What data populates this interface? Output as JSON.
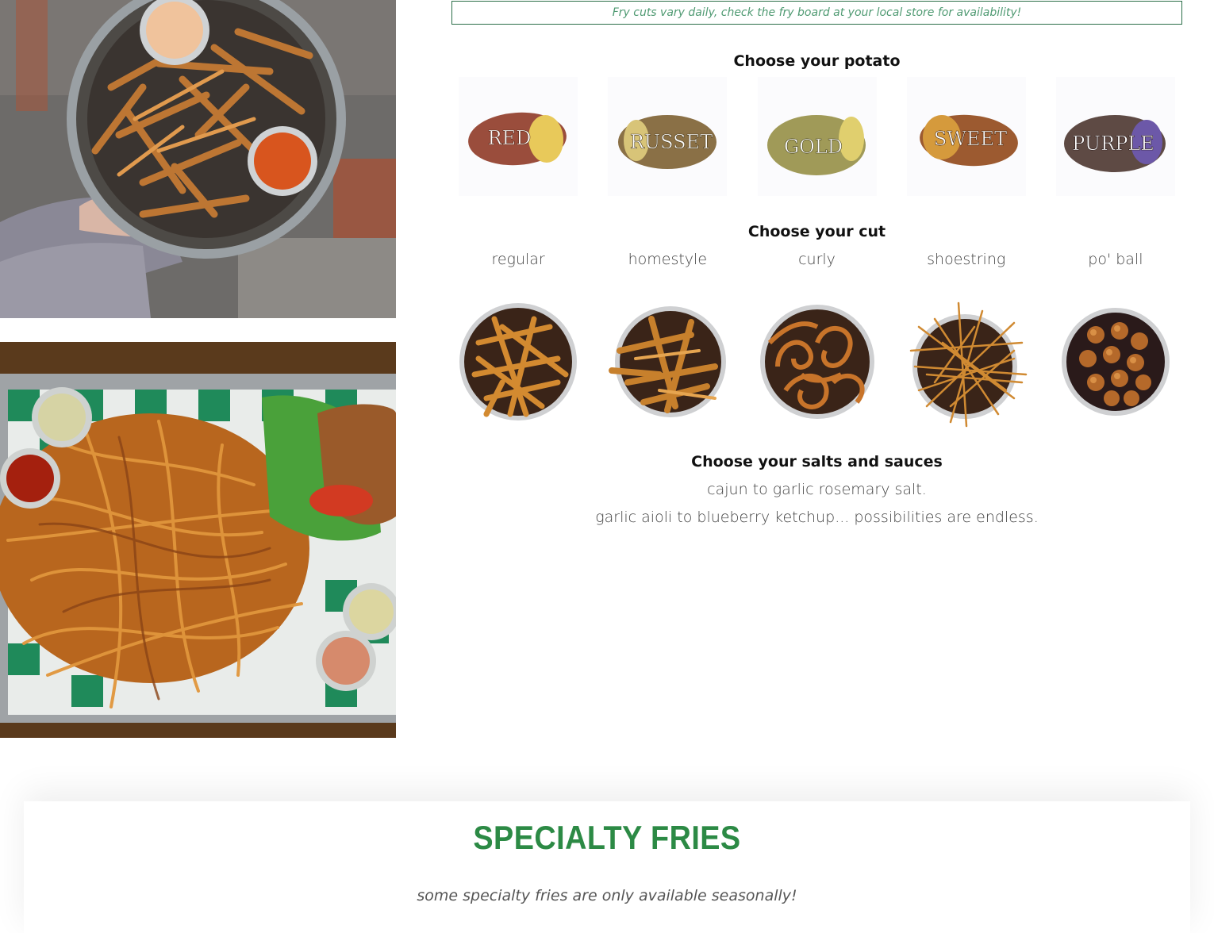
{
  "notice": "Fry cuts vary daily, check the fry board at your local store for availability!",
  "potato_section": {
    "title": "Choose your potato",
    "potatoes": [
      {
        "label": "RED",
        "skin": "#9a4d3c",
        "flesh": "#e8c95a"
      },
      {
        "label": "RUSSET",
        "skin": "#8a7046",
        "flesh": "#d8c478"
      },
      {
        "label": "GOLD",
        "skin": "#a09a58",
        "flesh": "#e0cf6e"
      },
      {
        "label": "SWEET",
        "skin": "#9c5a30",
        "flesh": "#d59a3c"
      },
      {
        "label": "PURPLE",
        "skin": "#5e4a44",
        "flesh": "#6c58a8"
      }
    ]
  },
  "cut_section": {
    "title": "Choose your cut",
    "cuts": [
      {
        "label": "regular",
        "icon": "regular-fries-icon"
      },
      {
        "label": "homestyle",
        "icon": "homestyle-fries-icon"
      },
      {
        "label": "curly",
        "icon": "curly-fries-icon"
      },
      {
        "label": "shoestring",
        "icon": "shoestring-fries-icon"
      },
      {
        "label": "po' ball",
        "icon": "po-ball-icon"
      }
    ]
  },
  "sauce_section": {
    "title": "Choose your salts and sauces",
    "line1": "cajun to garlic rosemary salt.",
    "line2": "garlic aioli to blueberry ketchup... possibilities are endless."
  },
  "specialty": {
    "title": "SPECIALTY FRIES",
    "subtitle": "some specialty fries are only available seasonally!"
  },
  "colors": {
    "brand_green": "#2c8a45",
    "notice_border": "#2b6e48",
    "notice_text": "#4f9a72",
    "fry_color": "#c97a26"
  }
}
